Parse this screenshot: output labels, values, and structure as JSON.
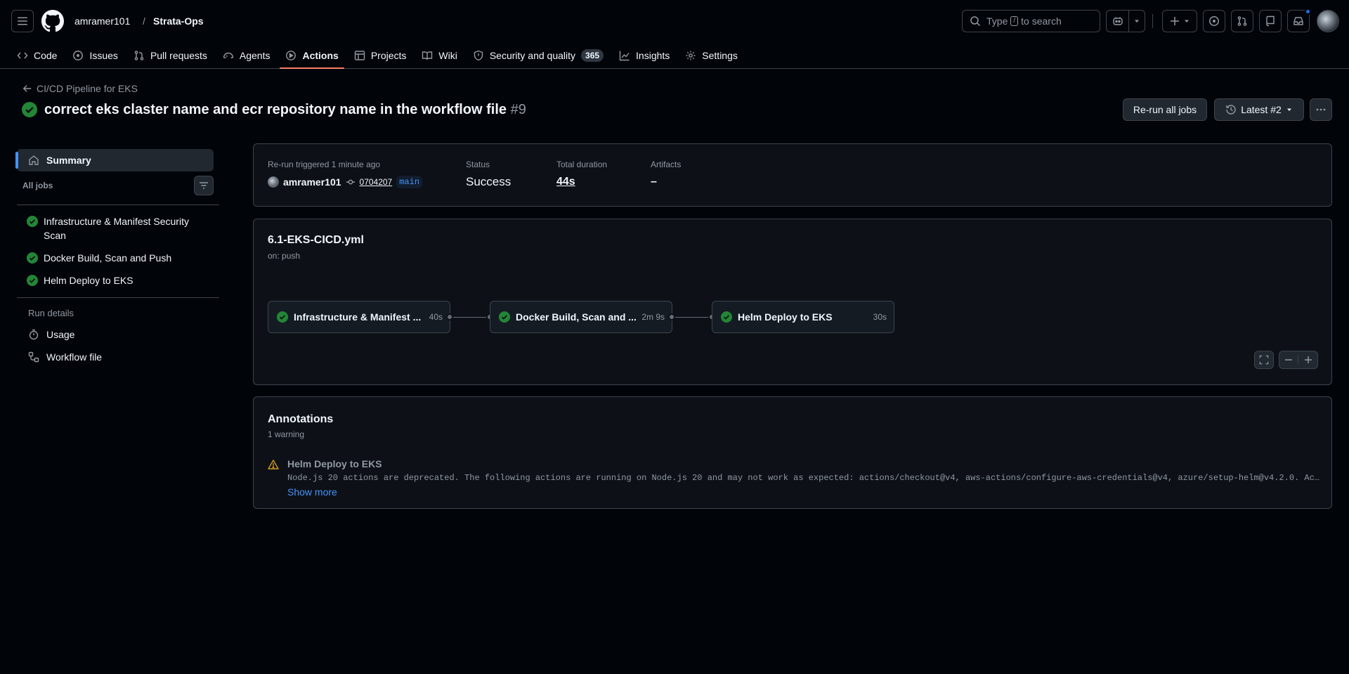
{
  "header": {
    "owner": "amramer101",
    "separator": "/",
    "repo": "Strata-Ops",
    "search_prefix": "Type",
    "search_key": "/",
    "search_suffix": "to search"
  },
  "nav": {
    "tabs": [
      {
        "label": "Code",
        "icon": "code-icon"
      },
      {
        "label": "Issues",
        "icon": "issue-icon"
      },
      {
        "label": "Pull requests",
        "icon": "pull-request-icon"
      },
      {
        "label": "Agents",
        "icon": "agent-icon"
      },
      {
        "label": "Actions",
        "icon": "play-icon"
      },
      {
        "label": "Projects",
        "icon": "table-icon"
      },
      {
        "label": "Wiki",
        "icon": "book-icon"
      },
      {
        "label": "Security and quality",
        "icon": "shield-icon",
        "counter": "365"
      },
      {
        "label": "Insights",
        "icon": "graph-icon"
      },
      {
        "label": "Settings",
        "icon": "gear-icon"
      }
    ],
    "active": "Actions"
  },
  "run": {
    "back_label": "CI/CD Pipeline for EKS",
    "title": "correct eks claster name and ecr repository name in the workflow file",
    "number": "#9",
    "rerun_label": "Re-run all jobs",
    "attempt_label": "Latest #2",
    "status_color": "#238636"
  },
  "sidebar": {
    "summary_label": "Summary",
    "all_jobs_label": "All jobs",
    "jobs": [
      {
        "label": "Infrastructure & Manifest Security Scan"
      },
      {
        "label": "Docker Build, Scan and Push"
      },
      {
        "label": "Helm Deploy to EKS"
      }
    ],
    "run_details_label": "Run details",
    "usage_label": "Usage",
    "workflow_file_label": "Workflow file"
  },
  "summary": {
    "trigger_label": "Re-run triggered 1 minute ago",
    "actor": "amramer101",
    "commit": "0704207",
    "branch": "main",
    "status_label": "Status",
    "status_value": "Success",
    "duration_label": "Total duration",
    "duration_value": "44s",
    "artifacts_label": "Artifacts",
    "artifacts_value": "–"
  },
  "workflow": {
    "file": "6.1-EKS-CICD.yml",
    "trigger": "on: push",
    "nodes": [
      {
        "label": "Infrastructure & Manifest ...",
        "duration": "40s"
      },
      {
        "label": "Docker Build, Scan and ...",
        "duration": "2m 9s"
      },
      {
        "label": "Helm Deploy to EKS",
        "duration": "30s"
      }
    ]
  },
  "annotations": {
    "title": "Annotations",
    "subtitle": "1 warning",
    "items": [
      {
        "job": "Helm Deploy to EKS",
        "message": "Node.js 20 actions are deprecated. The following actions are running on Node.js 20 and may not work as expected: actions/checkout@v4, aws-actions/configure-aws-credentials@v4, azure/setup-helm@v4.2.0. Ac…",
        "show_more": "Show more"
      }
    ]
  }
}
